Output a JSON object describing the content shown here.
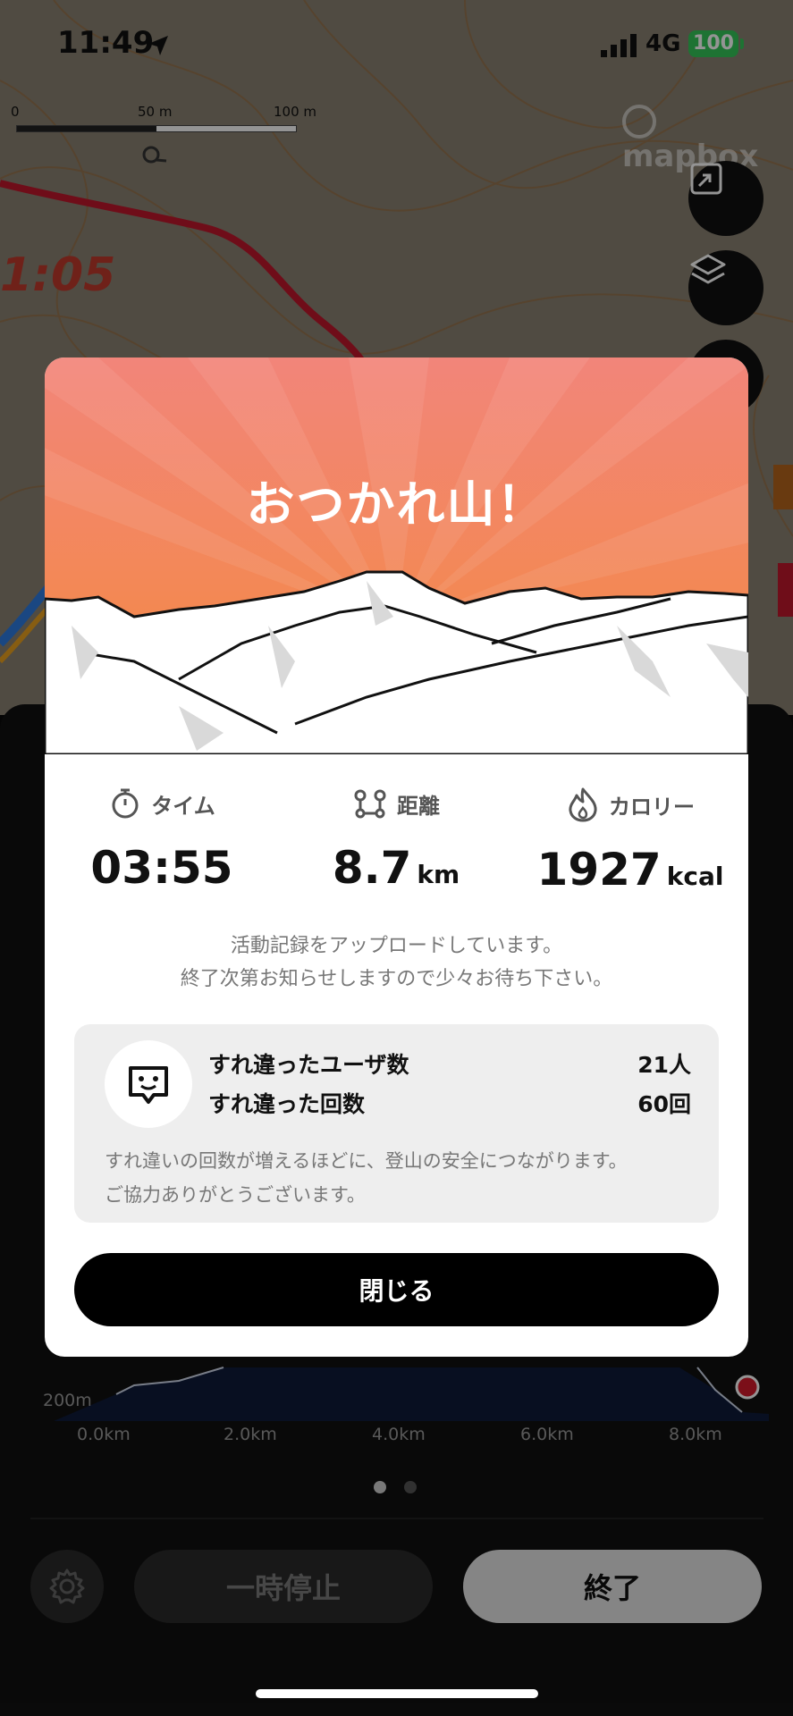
{
  "status_bar": {
    "time": "11:49",
    "network": "4G",
    "battery": "100"
  },
  "map": {
    "scale_labels": [
      "0",
      "50 m",
      "100 m"
    ],
    "attribution": "mapbox",
    "route_time_label": "1:05"
  },
  "modal": {
    "title": "おつかれ山！",
    "stats": [
      {
        "label": "タイム",
        "value": "03:55",
        "unit": "",
        "icon": "stopwatch-icon"
      },
      {
        "label": "距離",
        "value": "8.7",
        "unit": "km",
        "icon": "route-icon"
      },
      {
        "label": "カロリー",
        "value": "1927",
        "unit": "kcal",
        "icon": "flame-icon"
      }
    ],
    "upload_message_line1": "活動記録をアップロードしています。",
    "upload_message_line2": "終了次第お知らせしますので少々お待ち下さい。",
    "passing": {
      "users_label": "すれ違ったユーザ数",
      "users_value": "21人",
      "count_label": "すれ違った回数",
      "count_value": "60回",
      "note_line1": "すれ違いの回数が増えるほどに、登山の安全につながります。",
      "note_line2": "ご協力ありがとうございます。"
    },
    "close_label": "閉じる"
  },
  "sheet": {
    "elevation_label": "200m",
    "x_ticks": [
      "0.0km",
      "2.0km",
      "4.0km",
      "6.0km",
      "8.0km"
    ],
    "pause_label": "一時停止",
    "finish_label": "終了"
  },
  "colors": {
    "hero_top": "#f2857a",
    "hero_bottom": "#f48a3c",
    "route_red": "#c0182b",
    "battery_green": "#34c759"
  }
}
